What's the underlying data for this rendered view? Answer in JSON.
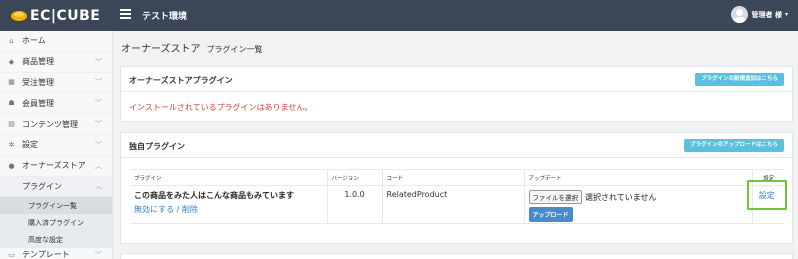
{
  "brand": {
    "name": "EC|CUBE",
    "logo_color": "#f0b400"
  },
  "header": {
    "site_name": "テスト環境",
    "user_name": "管理者 様",
    "bg_color": "#3b4656"
  },
  "sidebar": {
    "items": [
      {
        "icon": "home-icon",
        "glyph": "⌂",
        "label": "ホーム",
        "has_caret": false
      },
      {
        "icon": "tag-icon",
        "glyph": "◆",
        "label": "商品管理",
        "has_caret": true
      },
      {
        "icon": "cart-icon",
        "glyph": "▦",
        "label": "受注管理",
        "has_caret": true
      },
      {
        "icon": "users-icon",
        "glyph": "☗",
        "label": "会員管理",
        "has_caret": true
      },
      {
        "icon": "file-icon",
        "glyph": "▤",
        "label": "コンテンツ管理",
        "has_caret": true
      },
      {
        "icon": "gear-icon",
        "glyph": "✲",
        "label": "設定",
        "has_caret": true
      },
      {
        "icon": "info-icon",
        "glyph": "●",
        "label": "オーナーズストア",
        "has_caret": true
      }
    ],
    "submenu": {
      "label": "プラグイン",
      "caret": "^"
    },
    "subsub": [
      {
        "label": "プラグイン一覧",
        "active": true
      },
      {
        "label": "購入済プラグイン",
        "active": false
      },
      {
        "label": "高度な設定",
        "active": false
      }
    ],
    "partial_label": "テンプレート"
  },
  "page": {
    "title": "オーナーズストア",
    "subtitle": "プラグイン一覧"
  },
  "store_card": {
    "title": "オーナーズストアプラグイン",
    "button": "プラグインの新規追加はこちら",
    "notice": "インストールされているプラグインはありません。"
  },
  "own_card": {
    "title": "独自プラグイン",
    "button": "プラグインのアップロードはこちら",
    "columns": {
      "plugin": "プラグイン",
      "version": "バージョン",
      "code": "コード",
      "update": "アップデート",
      "settings": "設定"
    },
    "row": {
      "name": "この商品をみた人はこんな商品もみています",
      "disable_link": "無効にする",
      "separator": "/",
      "delete_link": "削除",
      "version": "1.0.0",
      "code": "RelatedProduct",
      "file_button": "ファイルを選択",
      "file_status": "選択されていません",
      "upload_button": "アップロード",
      "settings_link": "設定"
    }
  },
  "colors": {
    "accent": "#5bc0de",
    "link": "#2b7cd3",
    "alert": "#d2473a",
    "highlight": "#6cc73a",
    "upload": "#4a8ac9"
  }
}
